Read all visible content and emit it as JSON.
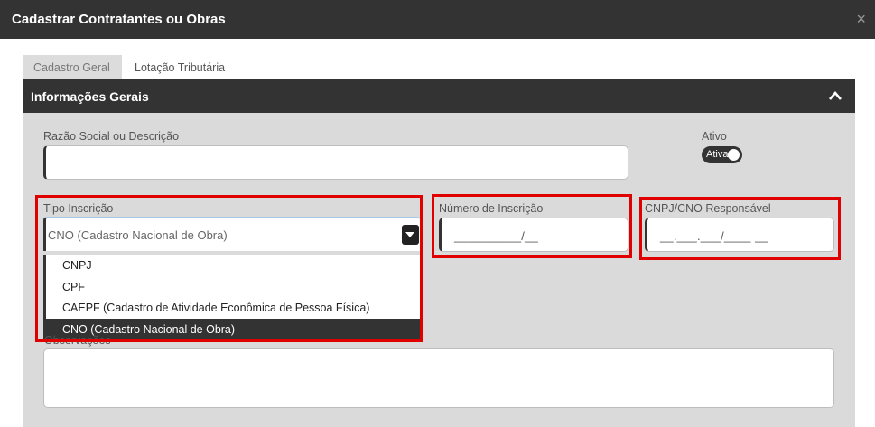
{
  "dialog": {
    "title": "Cadastrar Contratantes ou Obras",
    "close_symbol": "×"
  },
  "tabs": [
    {
      "label": "Cadastro Geral",
      "active": true
    },
    {
      "label": "Lotação Tributária",
      "active": false
    }
  ],
  "panel": {
    "title": "Informações Gerais",
    "chevron_icon": "chevron-up-icon"
  },
  "form": {
    "razao_social": {
      "label": "Razão Social ou Descrição",
      "value": ""
    },
    "ativo": {
      "label": "Ativo",
      "toggle_text": "Ativa",
      "on": true
    },
    "tipo_inscricao": {
      "label": "Tipo Inscrição",
      "selected": "CNO (Cadastro Nacional de Obra)",
      "options": [
        "CNPJ",
        "CPF",
        "CAEPF (Cadastro de Atividade Econômica de Pessoa Física)",
        "CNO (Cadastro Nacional de Obra)"
      ]
    },
    "numero_inscricao": {
      "label": "Número de Inscrição",
      "mask": "__________/__"
    },
    "cnpj_cno_responsavel": {
      "label": "CNPJ/CNO Responsável",
      "mask": "__.___.___/____-__"
    },
    "observacoes": {
      "label": "Observações",
      "value": ""
    }
  },
  "colors": {
    "header_dark": "#333333",
    "panel_bg": "#dadada",
    "highlight_red": "#e00000",
    "select_focus": "#a8c7e6"
  }
}
